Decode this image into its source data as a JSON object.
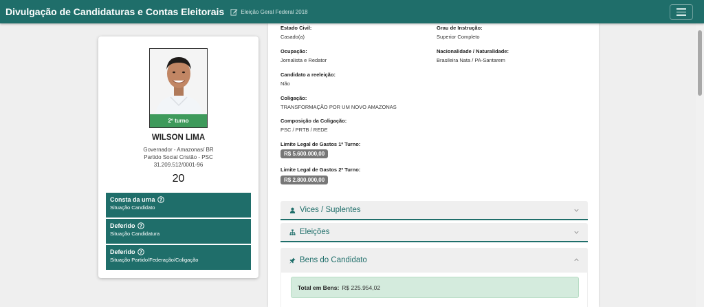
{
  "header": {
    "title": "Divulgação de Candidaturas e Contas Eleitorais",
    "election": "Eleição Geral Federal 2018",
    "edit_icon": "edit-icon",
    "menu_icon": "hamburger-menu-icon"
  },
  "candidate": {
    "turno": "2º turno",
    "name": "WILSON LIMA",
    "office": "Governador - Amazonas/ BR",
    "party": "Partido Social Cristão - PSC",
    "cnpj": "31.209.512/0001-96",
    "number": "20"
  },
  "status_boxes": [
    {
      "title": "Consta da urna",
      "subtitle": "Situação Candidato"
    },
    {
      "title": "Deferido",
      "subtitle": "Situação Candidatura"
    },
    {
      "title": "Deferido",
      "subtitle": "Situação Partido/Federação/Coligação"
    }
  ],
  "details": {
    "estado_civil_label": "Estado Civil:",
    "estado_civil": "Casado(a)",
    "grau_label": "Grau de Instrução:",
    "grau": "Superior Completo",
    "ocupacao_label": "Ocupação:",
    "ocupacao": "Jornalista e Redator",
    "nacionalidade_label": "Nacionalidade / Naturalidade:",
    "nacionalidade": "Brasileira Nata / PA-Santarem",
    "reeleicao_label": "Candidato a reeleição:",
    "reeleicao": "Não",
    "coligacao_label": "Coligação:",
    "coligacao": "TRANSFORMAÇÃO POR UM NOVO AMAZONAS",
    "composicao_label": "Composição da Coligação:",
    "composicao": "PSC / PRTB / REDE",
    "limite1_label": "Limite Legal de Gastos 1º Turno:",
    "limite1": "R$ 5.600.000,00",
    "limite2_label": "Limite Legal de Gastos 2º Turno:",
    "limite2": "R$ 2.800.000,00"
  },
  "accordion": [
    {
      "title": "Vices / Suplentes",
      "icon": "user-icon",
      "expanded": false
    },
    {
      "title": "Eleições",
      "icon": "sitemap-icon",
      "expanded": false
    },
    {
      "title": "Bens do Candidato",
      "icon": "pin-icon",
      "expanded": true
    }
  ],
  "bens": {
    "total_label": "Total em Bens:",
    "total_value": "R$ 225.954,02"
  },
  "colors": {
    "primary": "#1f6e6a",
    "turno_green": "#3e9a5b",
    "badge_gray": "#777777",
    "total_bg": "#d4ebdd"
  }
}
